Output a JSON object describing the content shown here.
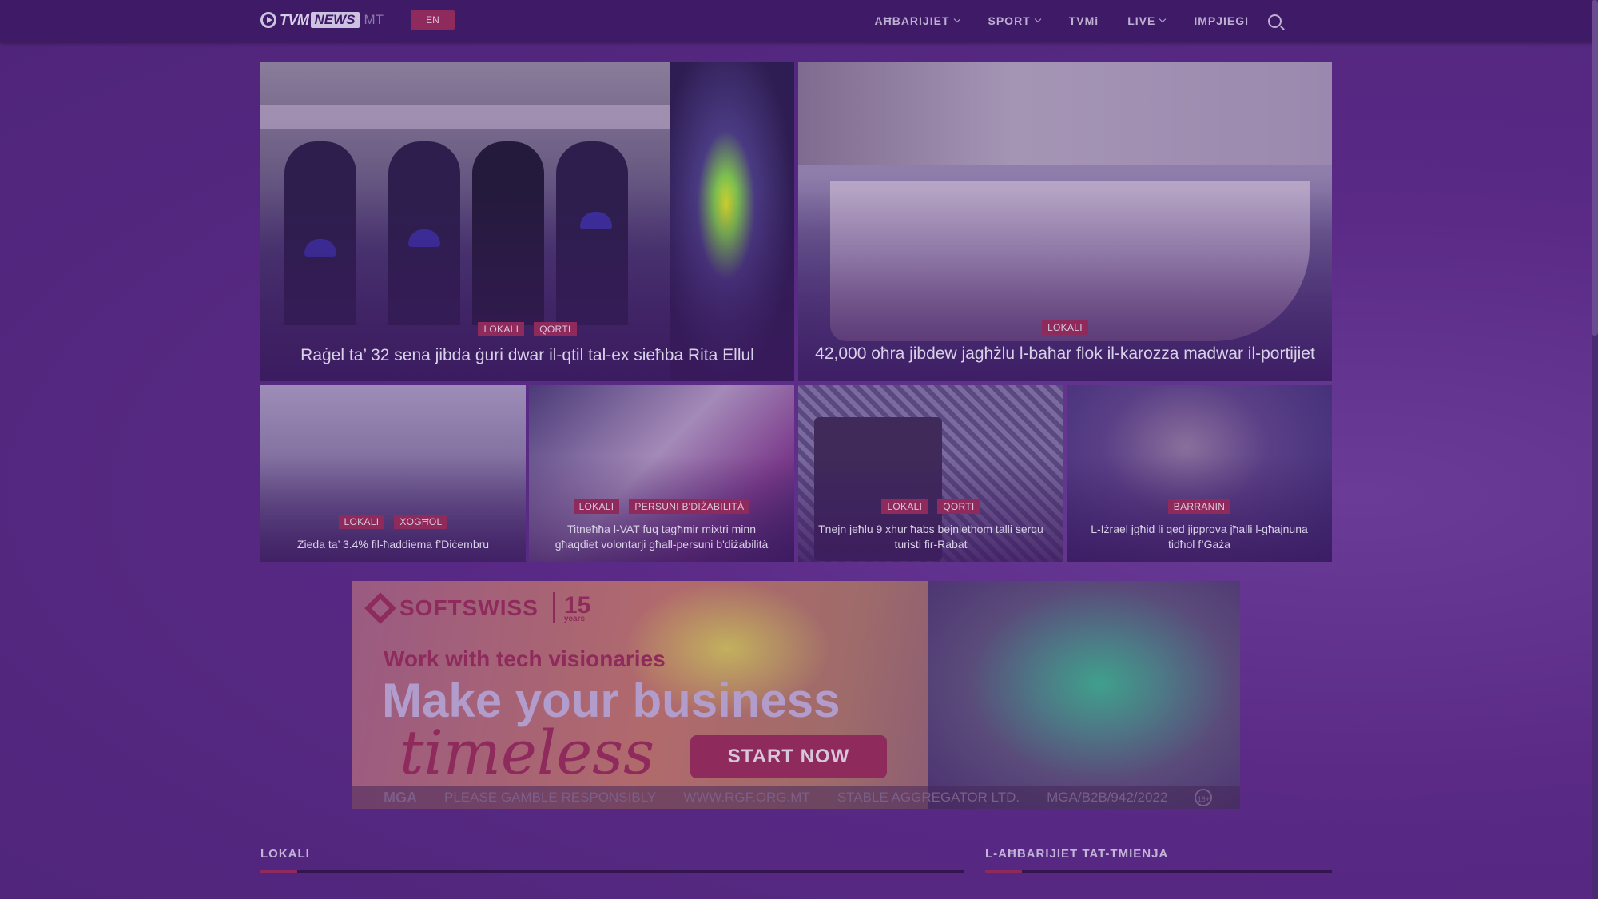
{
  "header": {
    "logo_text": "TVM",
    "logo_news": "NEWS",
    "lang_current": "MT",
    "lang_switch": "EN",
    "nav": [
      {
        "label": "AĦBARIJIET",
        "dropdown": true
      },
      {
        "label": "SPORT",
        "dropdown": true
      },
      {
        "label": "TVMi",
        "dropdown": false
      },
      {
        "label": "LIVE",
        "dropdown": true
      },
      {
        "label": "IMPJIEGI",
        "dropdown": false
      }
    ]
  },
  "featured": [
    {
      "tags": [
        "LOKALI",
        "QORTI"
      ],
      "headline": "Raġel ta’ 32 sena jibda ġuri dwar il-qtil tal-ex sieħba Rita Ellul"
    },
    {
      "tags": [
        "LOKALI"
      ],
      "headline": "42,000 oħra jibdew jagħżlu l-baħar flok il-karozza madwar il-portijiet"
    }
  ],
  "stories": [
    {
      "tags": [
        "LOKALI",
        "XOGĦOL"
      ],
      "headline": "Żieda ta’ 3.4% fil-ħaddiema f’Diċembru"
    },
    {
      "tags": [
        "LOKALI",
        "PERSUNI B'DIŻABILITÀ"
      ],
      "headline": "Titneħħa l-VAT fuq tagħmir mixtri minn għaqdiet volontarji għall-persuni b'diżabilità"
    },
    {
      "tags": [
        "LOKALI",
        "QORTI"
      ],
      "headline": "Tnejn jeħlu 9 xhur ħabs bejniethom talli serqu turisti fir-Rabat"
    },
    {
      "tags": [
        "BARRANIN"
      ],
      "headline": "L-Iżrael jgħid li qed jipprova jħalli l-għajnuna tidħol f’Gaża"
    }
  ],
  "ad": {
    "brand": "SOFTSWISS",
    "years_number": "15",
    "years_label": "years",
    "line1": "Work with tech visionaries",
    "line2": "Make your business",
    "line3": "timeless",
    "cta": "START NOW",
    "footer": [
      "MGA",
      "PLEASE GAMBLE RESPONSIBLY",
      "WWW.RGF.ORG.MT",
      "STABLE AGGREGATOR LTD.",
      "MGA/B2B/942/2022"
    ],
    "age_badge": "18+"
  },
  "sections": {
    "left": "LOKALI",
    "right": "L-AĦBARIJIET TAT-TMIENJA"
  },
  "colors": {
    "topbar": "#3f1a66",
    "accent": "#8e2a5c",
    "overlay": "#5a2a86"
  }
}
